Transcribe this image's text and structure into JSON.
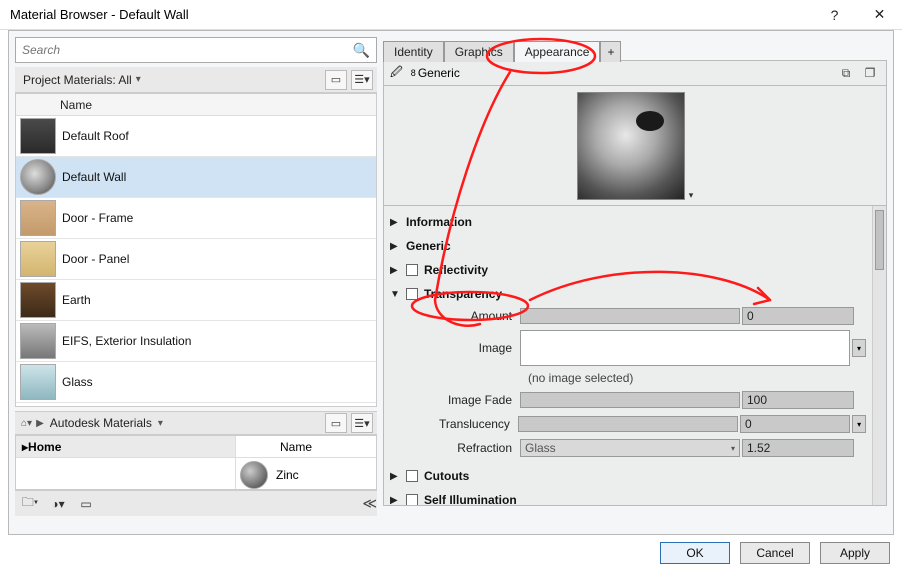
{
  "window": {
    "title": "Material Browser - Default Wall"
  },
  "search": {
    "placeholder": "Search"
  },
  "project_materials": {
    "label": "Project Materials: All"
  },
  "list": {
    "header": "Name",
    "items": [
      {
        "name": "Default Roof",
        "cls": "sw-roof"
      },
      {
        "name": "Default Wall",
        "cls": "sw-wall",
        "selected": true
      },
      {
        "name": "Door - Frame",
        "cls": "sw-frame"
      },
      {
        "name": "Door - Panel",
        "cls": "sw-panel"
      },
      {
        "name": "Earth",
        "cls": "sw-earth"
      },
      {
        "name": "EIFS, Exterior Insulation",
        "cls": "sw-eifs"
      },
      {
        "name": "Glass",
        "cls": "sw-glass"
      }
    ]
  },
  "library": {
    "crumb": "Autodesk Materials",
    "home": "Home",
    "header": "Name",
    "items": [
      {
        "name": "Zinc"
      }
    ]
  },
  "tabs": {
    "identity": "Identity",
    "graphics": "Graphics",
    "appearance": "Appearance",
    "add": "+"
  },
  "shader": {
    "count": "8",
    "name": "Generic"
  },
  "sections": {
    "information": "Information",
    "generic": "Generic",
    "reflectivity": "Reflectivity",
    "transparency": "Transparency",
    "cutouts": "Cutouts",
    "self_illumination": "Self Illumination"
  },
  "transparency": {
    "amount_label": "Amount",
    "amount_value": "0",
    "image_label": "Image",
    "image_note": "(no image selected)",
    "fade_label": "Image Fade",
    "fade_value": "100",
    "translucency_label": "Translucency",
    "translucency_value": "0",
    "refraction_label": "Refraction",
    "refraction_option": "Glass",
    "refraction_value": "1.52"
  },
  "buttons": {
    "ok": "OK",
    "cancel": "Cancel",
    "apply": "Apply"
  }
}
